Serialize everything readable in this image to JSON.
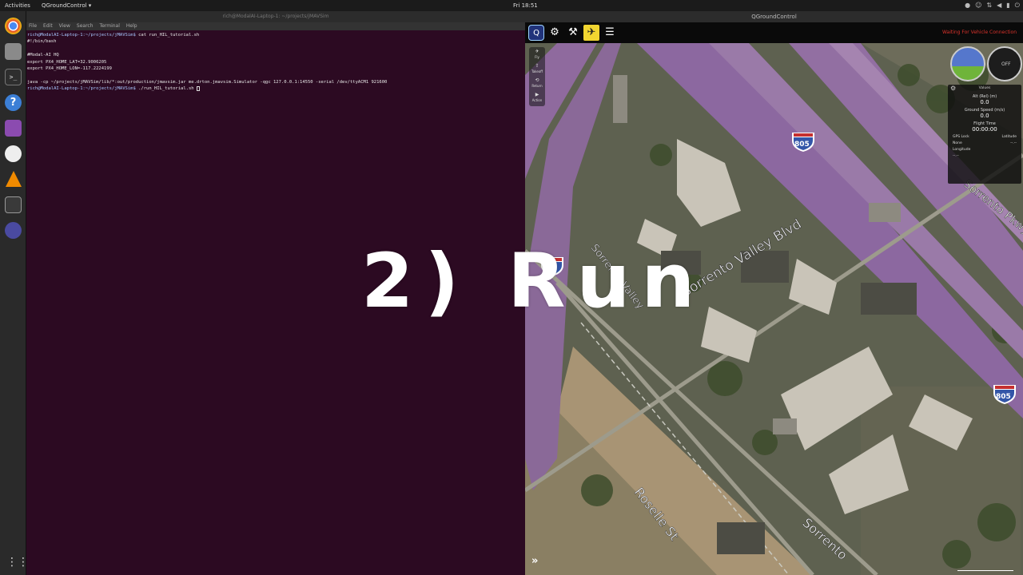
{
  "topbar": {
    "activities": "Activities",
    "app_menu": "QGroundControl ▾",
    "clock": "Fri 18:51",
    "tray_icons": [
      "record-icon",
      "accessibility-icon",
      "network-icon",
      "volume-icon",
      "battery-icon",
      "power-icon"
    ]
  },
  "dock": {
    "icons": [
      "chrome-icon",
      "files-icon",
      "terminal-icon",
      "help-icon",
      "screenshot-icon",
      "drawing-icon",
      "vlc-icon",
      "system-monitor-icon",
      "qgroundcontrol-icon",
      "app-grid-icon"
    ]
  },
  "terminal": {
    "title": "rich@ModalAI-Laptop-1: ~/projects/jMAVSim",
    "menu": [
      "File",
      "Edit",
      "View",
      "Search",
      "Terminal",
      "Help"
    ],
    "lines": [
      {
        "prompt": "rich@ModalAI-Laptop-1:~/projects/jMAVSim$",
        "text": " cat run_HIL_tutorial.sh"
      },
      {
        "prompt": "",
        "text": "#!/bin/bash"
      },
      {
        "prompt": "",
        "text": ""
      },
      {
        "prompt": "",
        "text": "#Modal-AI HQ"
      },
      {
        "prompt": "",
        "text": "export PX4_HOME_LAT=32.9006205"
      },
      {
        "prompt": "",
        "text": "export PX4_HOME_LON=-117.2224199"
      },
      {
        "prompt": "",
        "text": ""
      },
      {
        "prompt": "",
        "text": "java -cp ~/projects/jMAVSim/lib/*:out/production/jmavsim.jar me.drton.jmavsim.Simulator -qgc 127.0.0.1:14550 -serial /dev/ttyACM1 921600"
      },
      {
        "prompt": "rich@ModalAI-Laptop-1:~/projects/jMAVSim$",
        "text": " ./run_HIL_tutorial.sh "
      }
    ]
  },
  "qgc": {
    "title": "QGroundControl",
    "status": "Waiting For Vehicle Connection",
    "toolbar": [
      "qgc-logo-icon",
      "settings-icon",
      "vehicle-setup-icon",
      "plan-icon",
      "analyze-icon"
    ],
    "tools": [
      {
        "label": "Fly",
        "glyph": "✈"
      },
      {
        "label": "Takeoff",
        "glyph": "⇧"
      },
      {
        "label": "Return",
        "glyph": "⟲"
      },
      {
        "label": "Action",
        "glyph": "▶"
      }
    ],
    "values": {
      "header": "Values",
      "alt_label": "Alt (Rel) (m)",
      "alt_value": "0.0",
      "speed_label": "Ground Speed (m/s)",
      "speed_value": "0.0",
      "time_label": "Flight Time",
      "time_value": "00:00:00",
      "gps_label": "GPS Lock",
      "gps_value": "None",
      "lat_label": "Latitude",
      "lat_value": "--.--",
      "lon_label": "Longitude",
      "lon_value": "--.--"
    },
    "compass_label": "OFF",
    "map": {
      "labels": {
        "sorrento_valley": "Sorrento Valley Blvd",
        "sorrento_pkwy": "Sorrento Pkwy",
        "roselle": "Roselle St",
        "sorrento_lower": "Sorrento",
        "sorrento_left": "Sorrento Valley",
        "i805_top": "805",
        "i805_right": "805",
        "i5": "5"
      }
    }
  },
  "overlay": {
    "text": "2) Run"
  }
}
